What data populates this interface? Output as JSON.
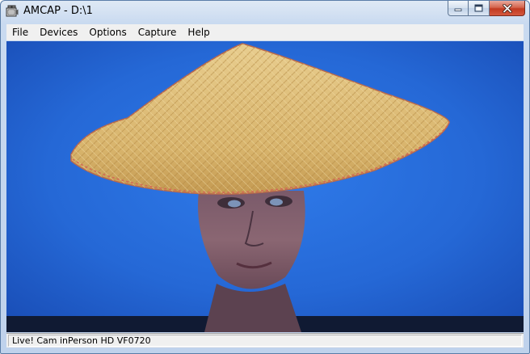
{
  "window": {
    "title": "AMCAP - D:\\1",
    "app_icon": "amcap-camera-icon"
  },
  "caption_buttons": {
    "minimize_icon": "minimize-icon",
    "maximize_icon": "maximize-icon",
    "close_icon": "close-icon"
  },
  "menu": {
    "items": [
      "File",
      "Devices",
      "Options",
      "Capture",
      "Help"
    ]
  },
  "video": {
    "description_icon": "live-preview-video",
    "background_color": "#2b6fd8"
  },
  "status": {
    "text": "Live! Cam inPerson HD VF0720"
  }
}
